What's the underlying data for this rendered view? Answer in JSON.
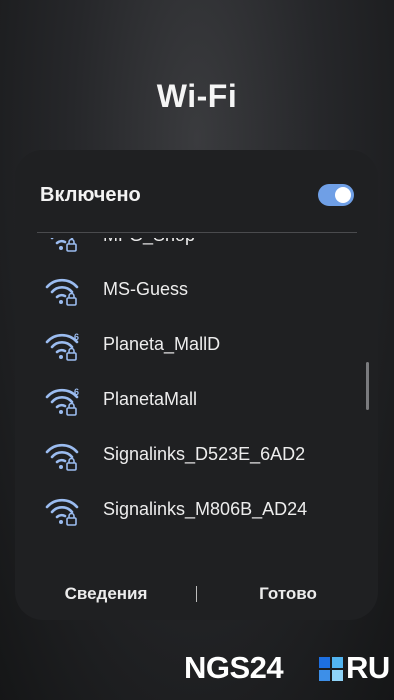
{
  "screen": {
    "title": "Wi-Fi"
  },
  "toggle": {
    "label": "Включено",
    "state": "on",
    "accent": "#6f9fe6"
  },
  "networks": [
    {
      "ssid": "MFG_Shop",
      "icon": "wifi-lock-icon",
      "badge": ""
    },
    {
      "ssid": "MS-Guess",
      "icon": "wifi-lock-icon",
      "badge": ""
    },
    {
      "ssid": "Planeta_MallD",
      "icon": "wifi6-lock-icon",
      "badge": "6"
    },
    {
      "ssid": "PlanetaMall",
      "icon": "wifi6-lock-icon",
      "badge": "6"
    },
    {
      "ssid": "Signalinks_D523E_6AD2",
      "icon": "wifi-lock-icon",
      "badge": ""
    },
    {
      "ssid": "Signalinks_M806B_AD24",
      "icon": "wifi-lock-icon",
      "badge": ""
    }
  ],
  "actions": {
    "details": "Сведения",
    "done": "Готово"
  },
  "watermark": {
    "left": "NGS24",
    "right": "RU",
    "colors": [
      "#1d6fe0",
      "#52b4f0",
      "#3d8fe8",
      "#8fd3f7"
    ]
  }
}
